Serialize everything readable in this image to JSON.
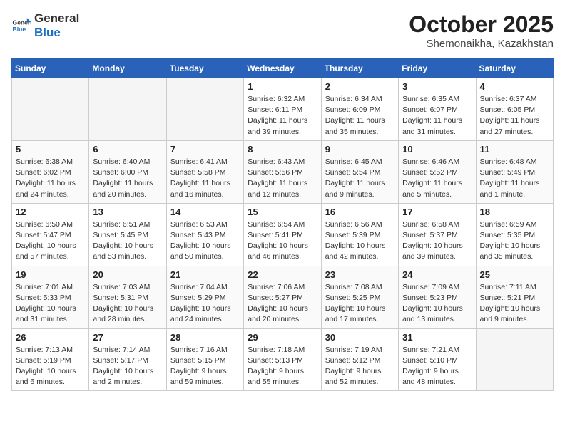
{
  "header": {
    "logo_line1": "General",
    "logo_line2": "Blue",
    "month_year": "October 2025",
    "location": "Shemonaikha, Kazakhstan"
  },
  "weekdays": [
    "Sunday",
    "Monday",
    "Tuesday",
    "Wednesday",
    "Thursday",
    "Friday",
    "Saturday"
  ],
  "weeks": [
    [
      {
        "day": "",
        "info": ""
      },
      {
        "day": "",
        "info": ""
      },
      {
        "day": "",
        "info": ""
      },
      {
        "day": "1",
        "info": "Sunrise: 6:32 AM\nSunset: 6:11 PM\nDaylight: 11 hours\nand 39 minutes."
      },
      {
        "day": "2",
        "info": "Sunrise: 6:34 AM\nSunset: 6:09 PM\nDaylight: 11 hours\nand 35 minutes."
      },
      {
        "day": "3",
        "info": "Sunrise: 6:35 AM\nSunset: 6:07 PM\nDaylight: 11 hours\nand 31 minutes."
      },
      {
        "day": "4",
        "info": "Sunrise: 6:37 AM\nSunset: 6:05 PM\nDaylight: 11 hours\nand 27 minutes."
      }
    ],
    [
      {
        "day": "5",
        "info": "Sunrise: 6:38 AM\nSunset: 6:02 PM\nDaylight: 11 hours\nand 24 minutes."
      },
      {
        "day": "6",
        "info": "Sunrise: 6:40 AM\nSunset: 6:00 PM\nDaylight: 11 hours\nand 20 minutes."
      },
      {
        "day": "7",
        "info": "Sunrise: 6:41 AM\nSunset: 5:58 PM\nDaylight: 11 hours\nand 16 minutes."
      },
      {
        "day": "8",
        "info": "Sunrise: 6:43 AM\nSunset: 5:56 PM\nDaylight: 11 hours\nand 12 minutes."
      },
      {
        "day": "9",
        "info": "Sunrise: 6:45 AM\nSunset: 5:54 PM\nDaylight: 11 hours\nand 9 minutes."
      },
      {
        "day": "10",
        "info": "Sunrise: 6:46 AM\nSunset: 5:52 PM\nDaylight: 11 hours\nand 5 minutes."
      },
      {
        "day": "11",
        "info": "Sunrise: 6:48 AM\nSunset: 5:49 PM\nDaylight: 11 hours\nand 1 minute."
      }
    ],
    [
      {
        "day": "12",
        "info": "Sunrise: 6:50 AM\nSunset: 5:47 PM\nDaylight: 10 hours\nand 57 minutes."
      },
      {
        "day": "13",
        "info": "Sunrise: 6:51 AM\nSunset: 5:45 PM\nDaylight: 10 hours\nand 53 minutes."
      },
      {
        "day": "14",
        "info": "Sunrise: 6:53 AM\nSunset: 5:43 PM\nDaylight: 10 hours\nand 50 minutes."
      },
      {
        "day": "15",
        "info": "Sunrise: 6:54 AM\nSunset: 5:41 PM\nDaylight: 10 hours\nand 46 minutes."
      },
      {
        "day": "16",
        "info": "Sunrise: 6:56 AM\nSunset: 5:39 PM\nDaylight: 10 hours\nand 42 minutes."
      },
      {
        "day": "17",
        "info": "Sunrise: 6:58 AM\nSunset: 5:37 PM\nDaylight: 10 hours\nand 39 minutes."
      },
      {
        "day": "18",
        "info": "Sunrise: 6:59 AM\nSunset: 5:35 PM\nDaylight: 10 hours\nand 35 minutes."
      }
    ],
    [
      {
        "day": "19",
        "info": "Sunrise: 7:01 AM\nSunset: 5:33 PM\nDaylight: 10 hours\nand 31 minutes."
      },
      {
        "day": "20",
        "info": "Sunrise: 7:03 AM\nSunset: 5:31 PM\nDaylight: 10 hours\nand 28 minutes."
      },
      {
        "day": "21",
        "info": "Sunrise: 7:04 AM\nSunset: 5:29 PM\nDaylight: 10 hours\nand 24 minutes."
      },
      {
        "day": "22",
        "info": "Sunrise: 7:06 AM\nSunset: 5:27 PM\nDaylight: 10 hours\nand 20 minutes."
      },
      {
        "day": "23",
        "info": "Sunrise: 7:08 AM\nSunset: 5:25 PM\nDaylight: 10 hours\nand 17 minutes."
      },
      {
        "day": "24",
        "info": "Sunrise: 7:09 AM\nSunset: 5:23 PM\nDaylight: 10 hours\nand 13 minutes."
      },
      {
        "day": "25",
        "info": "Sunrise: 7:11 AM\nSunset: 5:21 PM\nDaylight: 10 hours\nand 9 minutes."
      }
    ],
    [
      {
        "day": "26",
        "info": "Sunrise: 7:13 AM\nSunset: 5:19 PM\nDaylight: 10 hours\nand 6 minutes."
      },
      {
        "day": "27",
        "info": "Sunrise: 7:14 AM\nSunset: 5:17 PM\nDaylight: 10 hours\nand 2 minutes."
      },
      {
        "day": "28",
        "info": "Sunrise: 7:16 AM\nSunset: 5:15 PM\nDaylight: 9 hours\nand 59 minutes."
      },
      {
        "day": "29",
        "info": "Sunrise: 7:18 AM\nSunset: 5:13 PM\nDaylight: 9 hours\nand 55 minutes."
      },
      {
        "day": "30",
        "info": "Sunrise: 7:19 AM\nSunset: 5:12 PM\nDaylight: 9 hours\nand 52 minutes."
      },
      {
        "day": "31",
        "info": "Sunrise: 7:21 AM\nSunset: 5:10 PM\nDaylight: 9 hours\nand 48 minutes."
      },
      {
        "day": "",
        "info": ""
      }
    ]
  ]
}
